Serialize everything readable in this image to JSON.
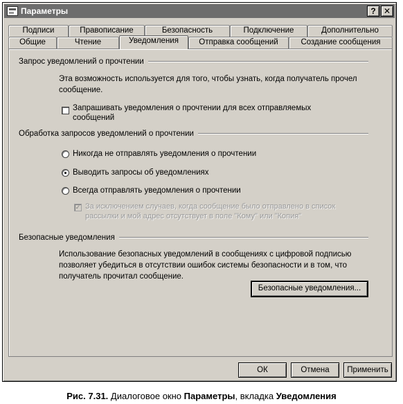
{
  "window": {
    "title": "Параметры",
    "help_btn": "?",
    "close_btn": "✕"
  },
  "tabs": {
    "back_row": [
      "Подписи",
      "Правописание",
      "Безопасность",
      "Подключение",
      "Дополнительно"
    ],
    "front_row": [
      "Общие",
      "Чтение",
      "Уведомления",
      "Отправка сообщений",
      "Создание сообщения"
    ],
    "active": "Уведомления"
  },
  "read_receipt": {
    "header": "Запрос уведомлений о прочтении",
    "description_line1": "Эта возможность используется для того, чтобы узнать, когда получатель прочел",
    "description_line2": "сообщение.",
    "checkbox_line1": "Запрашивать уведомления о прочтении для всех отправляемых",
    "checkbox_line2": "сообщений",
    "checkbox_checked": false
  },
  "receipt_handling": {
    "header": "Обработка запросов уведомлений о прочтении",
    "option_never": "Никогда не отправлять уведомления о прочтении",
    "option_notify": "Выводить запросы об уведомлениях",
    "option_always": "Всегда отправлять уведомления о прочтении",
    "selected": "option_notify",
    "except_line1": "За исключением случаев, когда сообщение было отправлено в список",
    "except_line2": "рассылки и мой адрес отсутствует в поле \"Кому\" или \"Копия\"",
    "except_checked": true
  },
  "secure_receipts": {
    "header": "Безопасные уведомления",
    "description_line1": "Использование безопасных уведомлений в сообщениях с цифровой подписью",
    "description_line2": "позволяет убедиться в отсутствии ошибок системы безопасности и в том, что",
    "description_line3": "получатель прочитал сообщение.",
    "button": "Безопасные уведомления..."
  },
  "footer": {
    "ok": "ОК",
    "cancel": "Отмена",
    "apply": "Применить"
  },
  "caption": {
    "prefix": "Рис. 7.31.",
    "text1": "Диалоговое окно",
    "bold1": "Параметры",
    "text2": ", вкладка",
    "bold2": "Уведомления"
  }
}
